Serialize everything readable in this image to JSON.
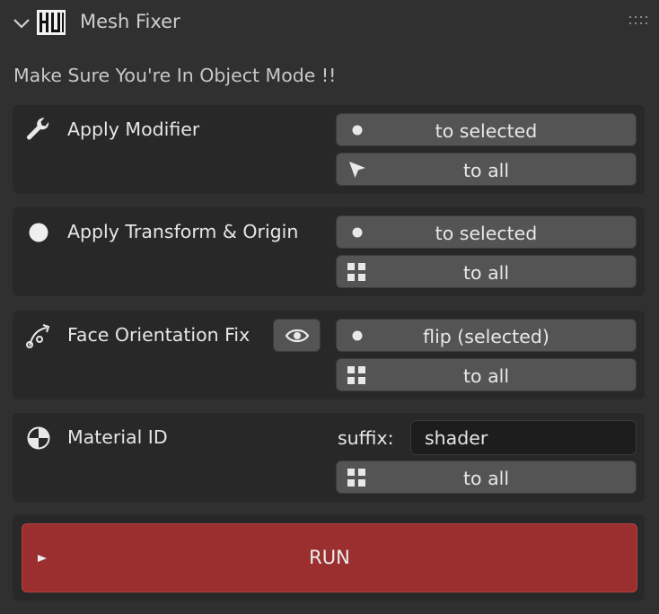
{
  "panel": {
    "title": "Mesh Fixer",
    "logo_text": "HUI",
    "warning": "Make Sure You're In Object Mode !!"
  },
  "sections": {
    "apply_modifier": {
      "label": "Apply Modifier",
      "btn_selected": "to selected",
      "btn_all": "to all"
    },
    "apply_transform": {
      "label": "Apply Transform & Origin",
      "btn_selected": "to selected",
      "btn_all": "to all"
    },
    "face_orientation": {
      "label": "Face Orientation Fix",
      "btn_selected": "flip (selected)",
      "btn_all": "to all"
    },
    "material_id": {
      "label": "Material ID",
      "suffix_label": "suffix:",
      "suffix_value": "shader",
      "btn_all": "to all"
    }
  },
  "run": {
    "label": "RUN"
  },
  "colors": {
    "run": "#9b2f2f",
    "button": "#545454",
    "panel": "#303030",
    "box": "#282828"
  }
}
